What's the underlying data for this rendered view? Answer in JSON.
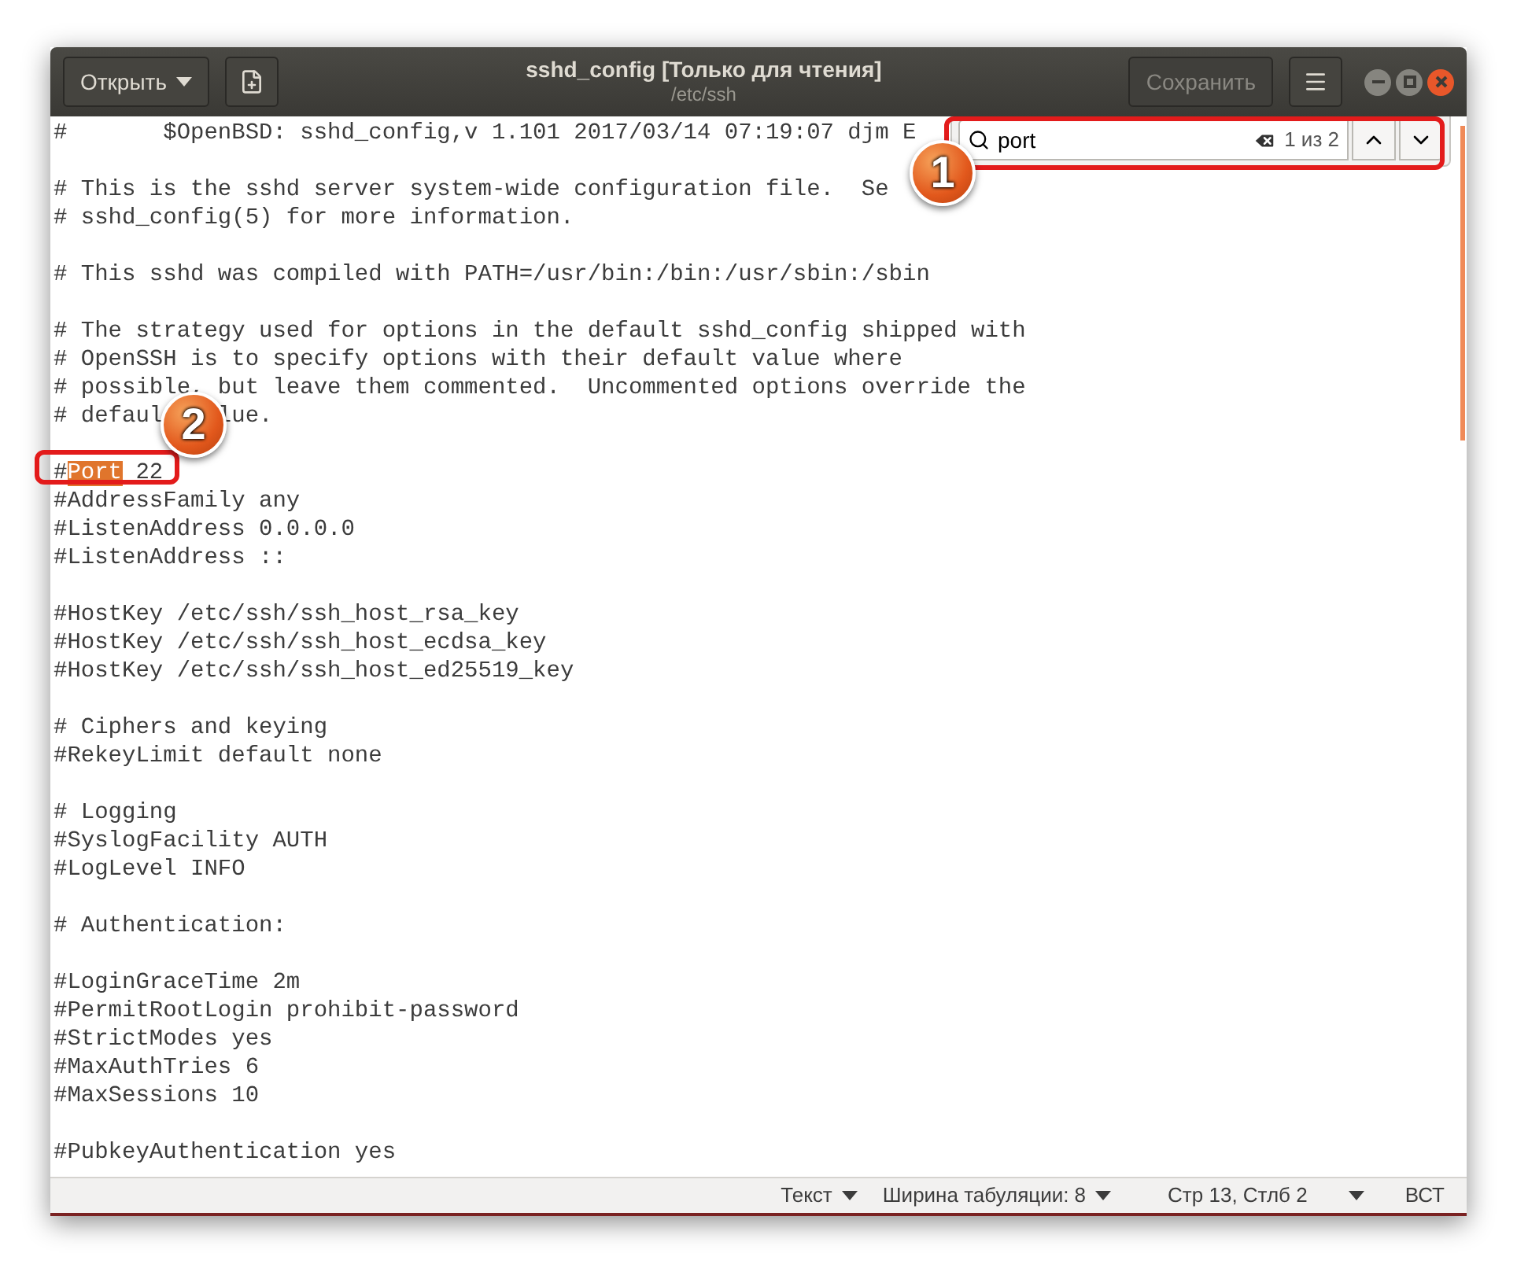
{
  "window": {
    "title": "sshd_config [Только для чтения]",
    "subtitle": "/etc/ssh",
    "open_button": "Открыть",
    "save_button": "Сохранить"
  },
  "search": {
    "value": "port",
    "count": "1 из 2"
  },
  "lines": [
    {
      "kind": "text",
      "text": "#       $OpenBSD: sshd_config,v 1.101 2017/03/14 07:19:07 djm E"
    },
    {
      "kind": "blank"
    },
    {
      "kind": "text",
      "text": "# This is the sshd server system-wide configuration file.  Se"
    },
    {
      "kind": "text",
      "text": "# sshd_config(5) for more information."
    },
    {
      "kind": "blank"
    },
    {
      "kind": "text",
      "text": "# This sshd was compiled with PATH=/usr/bin:/bin:/usr/sbin:/sbin"
    },
    {
      "kind": "blank"
    },
    {
      "kind": "text",
      "text": "# The strategy used for options in the default sshd_config shipped with"
    },
    {
      "kind": "text",
      "text": "# OpenSSH is to specify options with their default value where"
    },
    {
      "kind": "text",
      "text": "# possible, but leave them commented.  Uncommented options override the"
    },
    {
      "kind": "covered",
      "parts": [
        "# defaul",
        "lue."
      ]
    },
    {
      "kind": "blank"
    },
    {
      "kind": "match",
      "before": "#",
      "match": "Port",
      "after": " 22"
    },
    {
      "kind": "text",
      "text": "#AddressFamily any"
    },
    {
      "kind": "text",
      "text": "#ListenAddress 0.0.0.0"
    },
    {
      "kind": "text",
      "text": "#ListenAddress ::"
    },
    {
      "kind": "blank"
    },
    {
      "kind": "text",
      "text": "#HostKey /etc/ssh/ssh_host_rsa_key"
    },
    {
      "kind": "text",
      "text": "#HostKey /etc/ssh/ssh_host_ecdsa_key"
    },
    {
      "kind": "text",
      "text": "#HostKey /etc/ssh/ssh_host_ed25519_key"
    },
    {
      "kind": "blank"
    },
    {
      "kind": "text",
      "text": "# Ciphers and keying"
    },
    {
      "kind": "text",
      "text": "#RekeyLimit default none"
    },
    {
      "kind": "blank"
    },
    {
      "kind": "text",
      "text": "# Logging"
    },
    {
      "kind": "text",
      "text": "#SyslogFacility AUTH"
    },
    {
      "kind": "text",
      "text": "#LogLevel INFO"
    },
    {
      "kind": "blank"
    },
    {
      "kind": "text",
      "text": "# Authentication:"
    },
    {
      "kind": "blank"
    },
    {
      "kind": "text",
      "text": "#LoginGraceTime 2m"
    },
    {
      "kind": "text",
      "text": "#PermitRootLogin prohibit-password"
    },
    {
      "kind": "text",
      "text": "#StrictModes yes"
    },
    {
      "kind": "text",
      "text": "#MaxAuthTries 6"
    },
    {
      "kind": "text",
      "text": "#MaxSessions 10"
    },
    {
      "kind": "blank"
    },
    {
      "kind": "text",
      "text": "#PubkeyAuthentication yes"
    }
  ],
  "status_bar": {
    "syntax": "Текст",
    "tab_width": "Ширина табуляции: 8",
    "position": "Стр 13, Стлб 2",
    "mode": "ВСТ"
  },
  "annotations": [
    {
      "label": "1"
    },
    {
      "label": "2"
    }
  ]
}
